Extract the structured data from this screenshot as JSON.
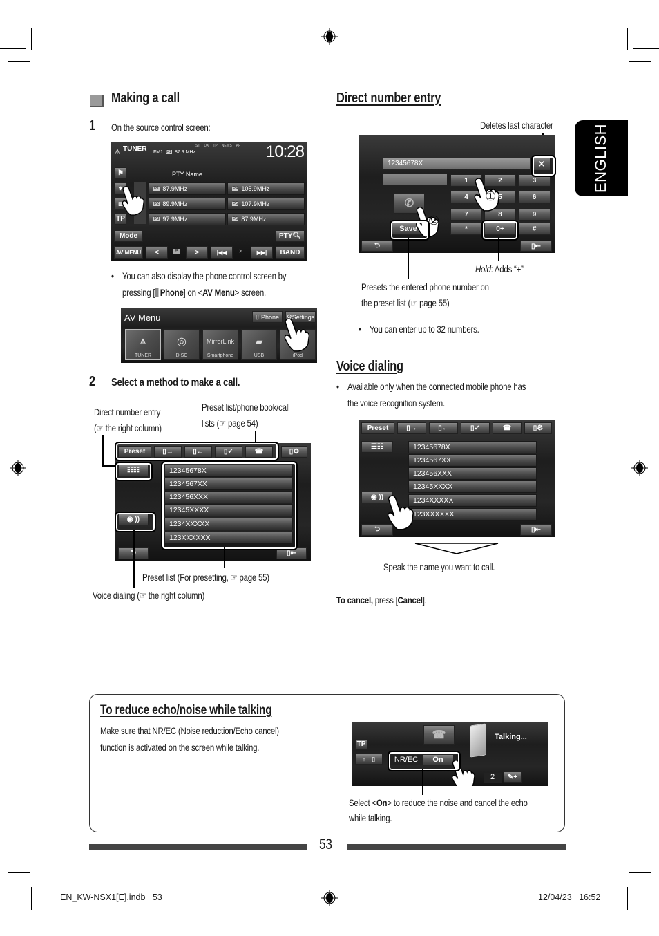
{
  "english_tab": "ENGLISH",
  "page_number": "53",
  "footer": {
    "file": "EN_KW-NSX1[E].indb   53",
    "datetime": "12/04/23   16:52"
  },
  "left": {
    "section_title": "Making a call",
    "step1": {
      "num": "1",
      "text": "On the source control screen:"
    },
    "tuner_screen": {
      "source": "TUNER",
      "band_info": "FM1",
      "preset_badge": "P1",
      "frequency": "87.9 MHz",
      "indicators": [
        "ST",
        "DX",
        "TP",
        "NEWS",
        "AF"
      ],
      "clock": "10:28",
      "pty_name": "PTY Name",
      "presets": [
        {
          "badge": "P1",
          "freq": "87.9MHz"
        },
        {
          "badge": "P4",
          "freq": "105.9MHz"
        },
        {
          "badge": "P2",
          "freq": "89.9MHz"
        },
        {
          "badge": "P5",
          "freq": "107.9MHz"
        },
        {
          "badge": "P3",
          "freq": "97.9MHz"
        },
        {
          "badge": "P6",
          "freq": "87.9MHz"
        }
      ],
      "left_buttons": [
        "TP"
      ],
      "mode_label": "Mode",
      "pty_label": "PTY",
      "bottom_bar": [
        "AV MENU",
        "<",
        "P",
        ">",
        "|◀◀",
        "✕",
        "▶▶|",
        "BAND"
      ]
    },
    "bullet1_line1": "You can also display the phone control screen by",
    "bullet1_line2_a": "pressing [",
    "bullet1_line2_phone": "Phone",
    "bullet1_line2_b": "] on <",
    "bullet1_line2_avmenu": "AV Menu",
    "bullet1_line2_c": "> screen.",
    "av_menu": {
      "title": "AV Menu",
      "phone_btn": "Phone",
      "settings_btn": "Settings",
      "tiles": [
        "TUNER",
        "DISC",
        "Smartphone",
        "USB",
        "iPod"
      ],
      "mirrorlink": "MirrorLink"
    },
    "step2": {
      "num": "2",
      "text": "Select a method to make a call."
    },
    "callouts": {
      "direct_l1": "Direct number entry",
      "direct_l2": "(☞ the right column)",
      "preset_l1": "Preset list/phone book/call",
      "preset_l2": "lists (☞ page 54)",
      "preset_list": "Preset list (For presetting, ☞ page 55)",
      "voice": "Voice dialing (☞ the right column)"
    },
    "phone_screen": {
      "tabs": [
        "Preset",
        "▯→",
        "▯←",
        "▯✓",
        "☎",
        "▯⚙"
      ],
      "numbers": [
        "12345678X",
        "1234567XX",
        "123456XXX",
        "12345XXXX",
        "1234XXXXX",
        "123XXXXXX"
      ]
    }
  },
  "right": {
    "direct_title": "Direct number entry",
    "deletes_label": "Deletes last character",
    "keypad_screen": {
      "entry_value": "12345678X",
      "keys": [
        "1",
        "2",
        "3",
        "4",
        "5",
        "6",
        "7",
        "8",
        "9",
        "*",
        "0+",
        "#"
      ],
      "save_label": "Save",
      "circle1": "①",
      "circle2": "②"
    },
    "hold_label_italic": "Hold",
    "hold_label_rest": ": Adds “+”",
    "presets_l1": "Presets the entered phone number on",
    "presets_l2": "the preset list (☞ page 55)",
    "bullet_32": "You can enter up to 32 numbers.",
    "voice_title": "Voice dialing",
    "voice_bullet_l1": "Available only when the connected mobile phone has",
    "voice_bullet_l2": "the voice recognition system.",
    "speak_label": "Speak the name you want to call.",
    "cancel_bold": "To cancel,",
    "cancel_mid": " press [",
    "cancel_btn": "Cancel",
    "cancel_end": "]."
  },
  "box": {
    "title": "To reduce echo/noise while talking",
    "body_l1": "Make sure that NR/EC (Noise reduction/Echo cancel)",
    "body_l2": "function is activated on the screen while talking.",
    "screen": {
      "tp": "TP",
      "transfer": "↑→▯",
      "nrec": "NR/EC",
      "on": "On",
      "talking": "Talking...",
      "count": "2"
    },
    "caption_a": "Select <",
    "caption_on": "On",
    "caption_b": "> to reduce the noise and cancel the echo",
    "caption_l2": "while talking."
  }
}
